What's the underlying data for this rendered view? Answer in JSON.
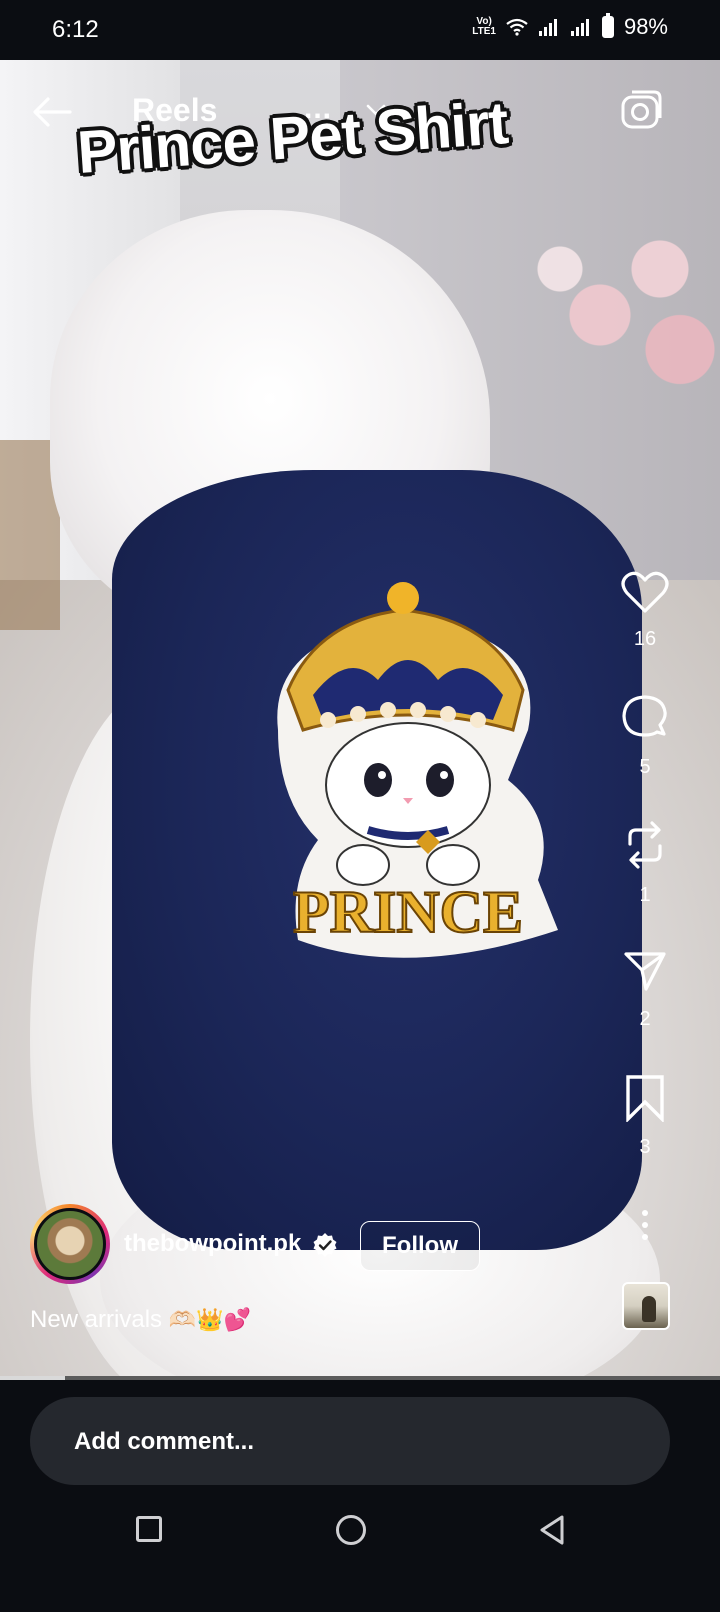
{
  "status_bar": {
    "time": "6:12",
    "volte": "Vo))\nLTE1",
    "battery": "98%"
  },
  "header": {
    "title": "Reels",
    "more": "...",
    "overlay_text": "Prince Pet Shirt"
  },
  "video": {
    "print_text": "PRINCE",
    "progress_fraction": 0.09
  },
  "actions": {
    "likes": "16",
    "comments": "5",
    "reposts": "1",
    "shares": "2",
    "saves": "3"
  },
  "post": {
    "username": "thebowpoint.pk",
    "follow_label": "Follow",
    "caption_text": "New arrivals ",
    "caption_emoji": "🫶🏻👑💕"
  },
  "comment": {
    "placeholder": "Add comment..."
  },
  "colors": {
    "background": "#0b0d12",
    "comment_box": "#25282e",
    "shirt": "#1b2657"
  }
}
